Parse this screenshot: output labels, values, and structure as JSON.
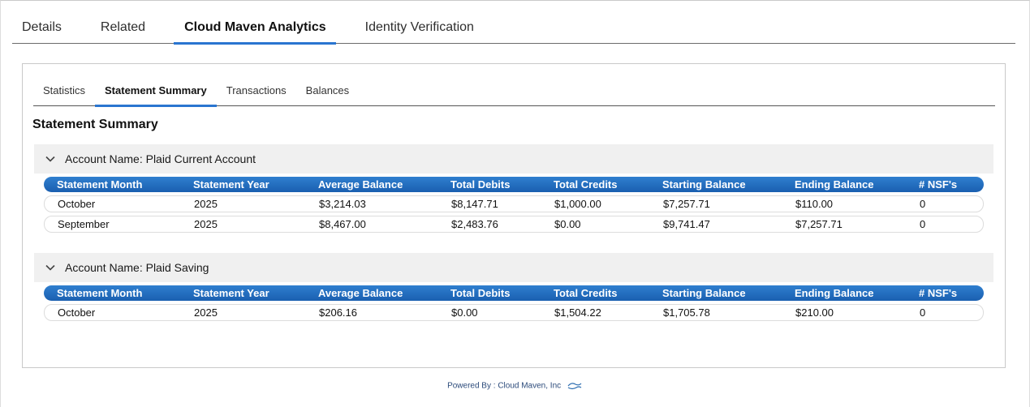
{
  "top_tabs": [
    {
      "label": "Details"
    },
    {
      "label": "Related"
    },
    {
      "label": "Cloud Maven Analytics"
    },
    {
      "label": "Identity Verification"
    }
  ],
  "sub_tabs": [
    {
      "label": "Statistics"
    },
    {
      "label": "Statement Summary"
    },
    {
      "label": "Transactions"
    },
    {
      "label": "Balances"
    }
  ],
  "section_title": "Statement Summary",
  "columns": [
    "Statement Month",
    "Statement Year",
    "Average Balance",
    "Total Debits",
    "Total Credits",
    "Starting Balance",
    "Ending Balance",
    "# NSF's"
  ],
  "accounts": [
    {
      "header": "Account Name: Plaid Current Account",
      "rows": [
        [
          "October",
          "2025",
          "$3,214.03",
          "$8,147.71",
          "$1,000.00",
          "$7,257.71",
          "$110.00",
          "0"
        ],
        [
          "September",
          "2025",
          "$8,467.00",
          "$2,483.76",
          "$0.00",
          "$9,741.47",
          "$7,257.71",
          "0"
        ]
      ]
    },
    {
      "header": "Account Name: Plaid Saving",
      "rows": [
        [
          "October",
          "2025",
          "$206.16",
          "$0.00",
          "$1,504.22",
          "$1,705.78",
          "$210.00",
          "0"
        ]
      ]
    }
  ],
  "footer": "Powered By : Cloud Maven, Inc",
  "colors": {
    "accent": "#2a75d0",
    "header_blue": "#1f6cc0"
  }
}
